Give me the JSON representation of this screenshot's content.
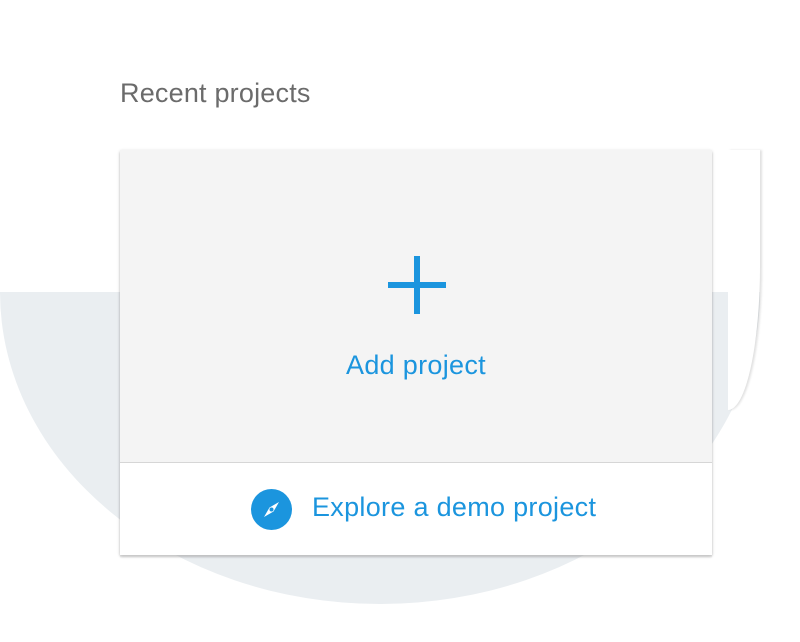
{
  "section": {
    "title": "Recent projects"
  },
  "add_project": {
    "icon": "plus-icon",
    "label": "Add project"
  },
  "demo_project": {
    "icon": "compass-icon",
    "label": "Explore a demo project"
  },
  "colors": {
    "accent": "#1b95de",
    "card_top_bg": "#f4f4f4",
    "backdrop": "#eaeef1",
    "title_text": "#6b6b6b"
  }
}
